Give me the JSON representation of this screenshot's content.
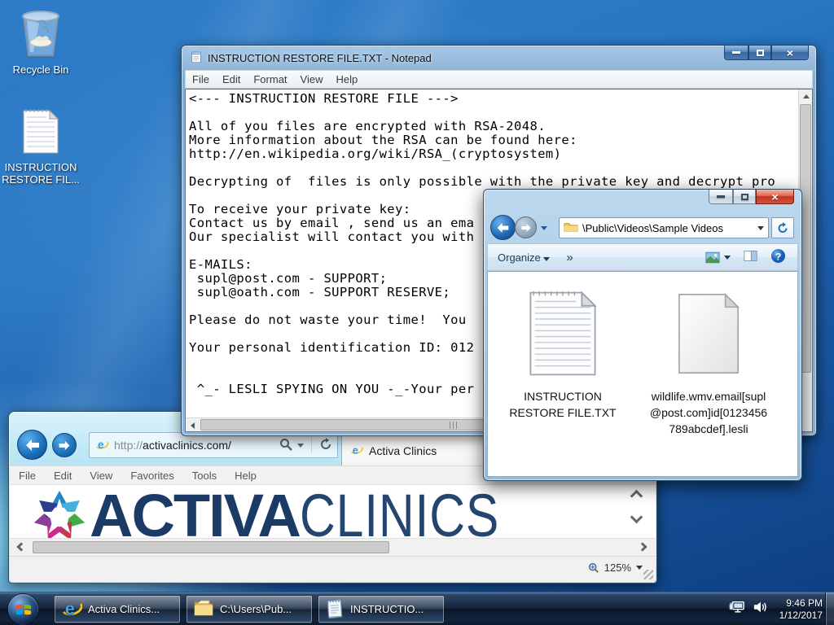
{
  "desktop": {
    "icons": [
      {
        "label": "Recycle Bin",
        "icon": "recycle-bin-icon"
      },
      {
        "label": "INSTRUCTION RESTORE FIL...",
        "icon": "text-file-icon"
      }
    ]
  },
  "notepad": {
    "title": "INSTRUCTION RESTORE FILE.TXT - Notepad",
    "menu": [
      "File",
      "Edit",
      "Format",
      "View",
      "Help"
    ],
    "content": "<--- INSTRUCTION RESTORE FILE --->\n\nAll of you files are encrypted with RSA-2048.\nMore information about the RSA can be found here:\nhttp://en.wikipedia.org/wiki/RSA_(cryptosystem)\n\nDecrypting of  files is only possible with the private key and decrypt pro\n\nTo receive your private key:\nContact us by email , send us an ema\nOur specialist will contact you with\n\nE-MAILS:\n supl@post.com - SUPPORT;\n supl@oath.com - SUPPORT RESERVE;\n\nPlease do not waste your time!  You \n\nYour personal identification ID: 012\n\n\n ^_- LESLI SPYING ON YOU -_-Your per"
  },
  "explorer": {
    "address": "\\Public\\Videos\\Sample Videos",
    "toolbar": {
      "organize": "Organize",
      "dropdown_glyph": "▾",
      "overflow_glyph": "»"
    },
    "files": [
      {
        "name": "INSTRUCTION RESTORE FILE.TXT",
        "icon": "text-file-icon"
      },
      {
        "name": "wildlife.wmv.email[supl@post.com]id[0123456789abcdef].lesli",
        "icon": "generic-file-icon"
      }
    ]
  },
  "ie": {
    "url_scheme": "http://",
    "url_host": "activaclinics.com/",
    "tab_title": "Activa Clinics",
    "menu": [
      "File",
      "Edit",
      "View",
      "Favorites",
      "Tools",
      "Help"
    ],
    "zoom_level": "125%",
    "logo": {
      "word_bold": "ACTIVA",
      "word_light": "CLINICS",
      "navy": "#1b3a66",
      "star_colors": [
        "#8a3f98",
        "#2b3f8f",
        "#1f86c8",
        "#45b0e0",
        "#3fae49",
        "#cc2a8c",
        "#c23a50"
      ]
    }
  },
  "taskbar": {
    "buttons": [
      {
        "label": "Activa Clinics...",
        "icon": "ie-icon"
      },
      {
        "label": "C:\\Users\\Pub...",
        "icon": "folder-icon"
      },
      {
        "label": "INSTRUCTIO...",
        "icon": "notepad-icon"
      }
    ],
    "tray": {
      "time": "9:46 PM",
      "date": "1/12/2017"
    }
  }
}
